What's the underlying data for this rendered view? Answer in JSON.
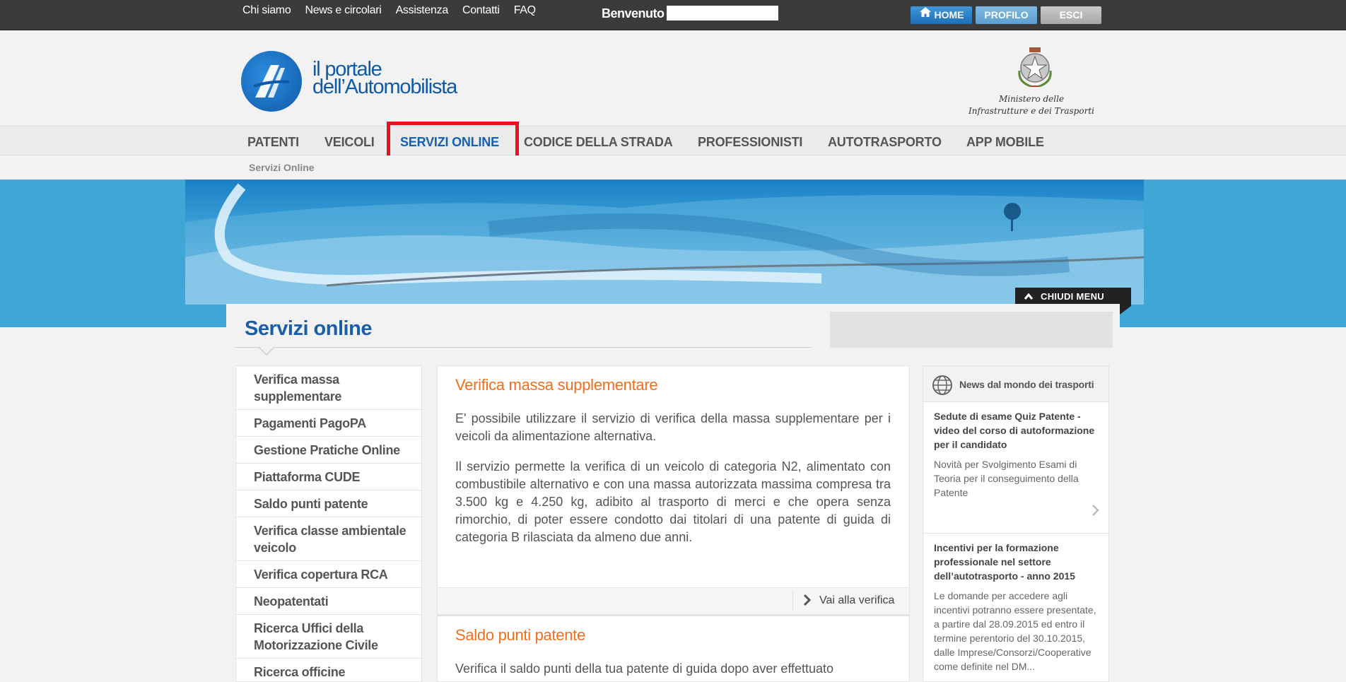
{
  "topbar": {
    "links": [
      "Chi siamo",
      "News e circolari",
      "Assistenza",
      "Contatti",
      "FAQ"
    ],
    "welcome": "Benvenuto",
    "home_label": "HOME",
    "profilo_label": "PROFILO",
    "esci_label": "ESCI"
  },
  "header": {
    "logo_line1": "il portale",
    "logo_line2": "dell’Automobilista",
    "ministry_line1": "Ministero delle",
    "ministry_line2": "Infrastrutture e dei Trasporti"
  },
  "nav": {
    "items": [
      "PATENTI",
      "VEICOLI",
      "SERVIZI ONLINE",
      "CODICE DELLA STRADA",
      "PROFESSIONISTI",
      "AUTOTRASPORTO",
      "APP MOBILE"
    ],
    "active_index": 2
  },
  "breadcrumb": "Servizi Online",
  "hero": {
    "close_menu_label": "CHIUDI MENU"
  },
  "page": {
    "title": "Servizi online"
  },
  "sidebar": {
    "items": [
      "Verifica massa supplementare",
      "Pagamenti PagoPA",
      "Gestione Pratiche Online",
      "Piattaforma CUDE",
      "Saldo punti patente",
      "Verifica classe ambientale veicolo",
      "Verifica copertura RCA",
      "Neopatentati",
      "Ricerca Uffici della Motorizzazione Civile",
      "Ricerca officine autorizzate"
    ]
  },
  "cards": [
    {
      "title": "Verifica massa supplementare",
      "p1": "E' possibile utilizzare il servizio di verifica della massa supplementare per i veicoli da alimentazione alternativa.",
      "p2": "Il servizio permette la verifica di un veicolo di categoria N2, alimentato con combustibile alternativo e con una massa autorizzata massima compresa tra 3.500 kg e 4.250 kg, adibito al trasporto di merci e che opera senza rimorchio, di poter essere condotto dai titolari di una patente di guida di categoria B rilasciata da almeno due anni.",
      "link": "Vai alla verifica"
    },
    {
      "title": "Saldo punti patente",
      "p1": "Verifica il saldo punti della tua patente di guida dopo aver effettuato"
    }
  ],
  "news": {
    "header": "News dal mondo dei trasporti",
    "items": [
      {
        "title": "Sedute di esame Quiz Patente - video del corso di autoformazione per il candidato",
        "body": "Novità per Svolgimento Esami di Teoria per il conseguimento della Patente"
      },
      {
        "title": "Incentivi per la formazione professionale nel settore dell’autotrasporto - anno 2015",
        "body": "Le domande per accedere agli incentivi potranno essere presentate, a partire dal 28.09.2015 ed entro il termine perentorio del 30.10.2015, dalle Imprese/Consorzi/Cooperative come definite nel DM..."
      }
    ]
  },
  "colors": {
    "accent_orange": "#f06e1e",
    "title_blue": "#1b5ea8",
    "highlight_red": "#e8101f",
    "topbar_dark": "#3b3b3b",
    "hero_blue": "#3fa7d6"
  }
}
